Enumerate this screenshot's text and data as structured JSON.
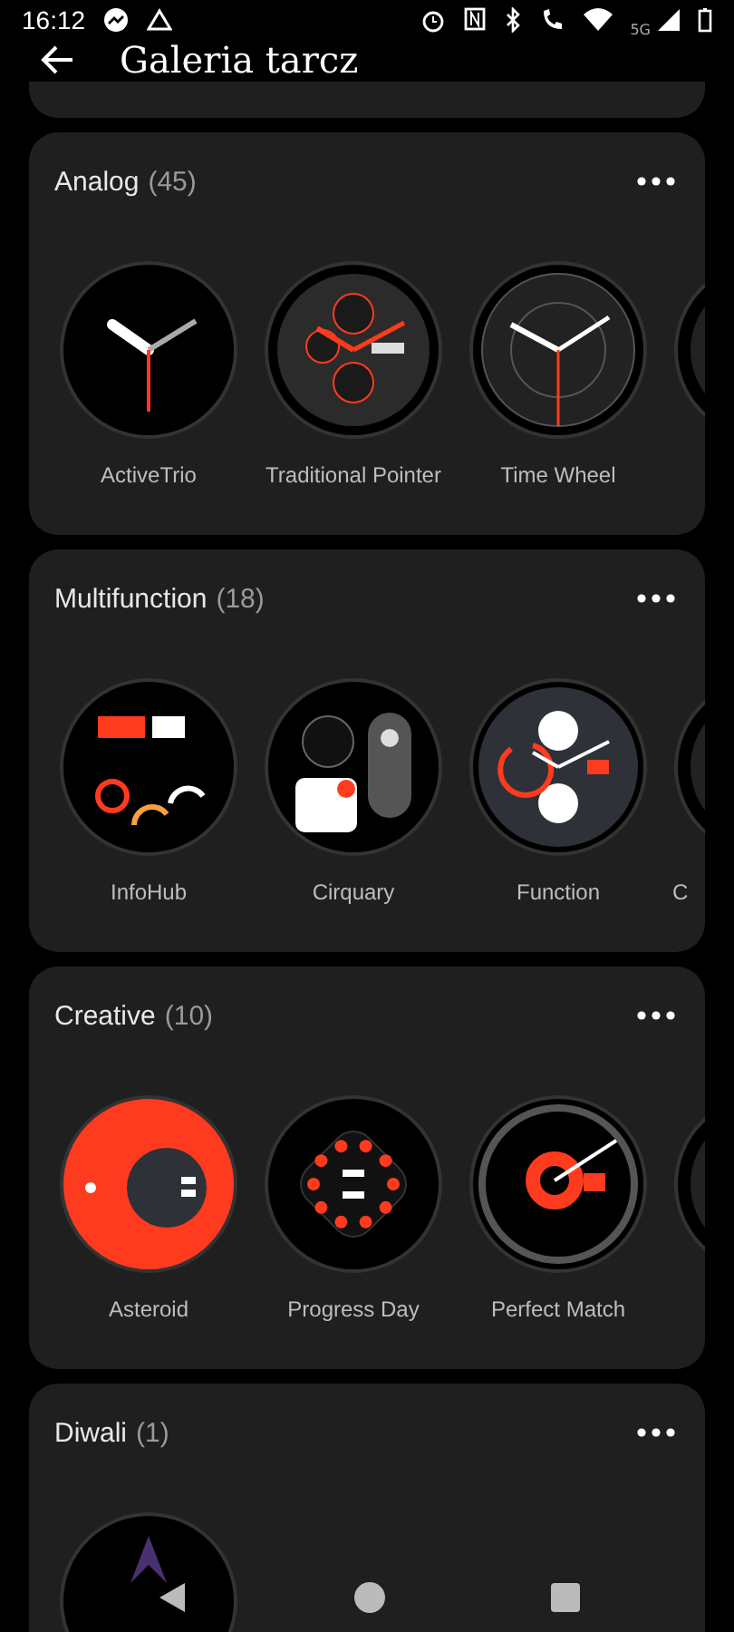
{
  "status_bar": {
    "time": "16:12",
    "network": "5G"
  },
  "header": {
    "title": "Galeria tarcz"
  },
  "categories": [
    {
      "name": "Analog",
      "count": "(45)",
      "faces": [
        {
          "kind": "trio",
          "label": "ActiveTrio"
        },
        {
          "kind": "chrono",
          "label": "Traditional Pointer"
        },
        {
          "kind": "wheel",
          "label": "Time Wheel"
        },
        {
          "kind": "edge"
        }
      ]
    },
    {
      "name": "Multifunction",
      "count": "(18)",
      "faces": [
        {
          "kind": "digital",
          "label": "InfoHub"
        },
        {
          "kind": "widgets",
          "label": "Cirquary"
        },
        {
          "kind": "function",
          "label": "Function"
        },
        {
          "kind": "edge",
          "label": "C"
        }
      ]
    },
    {
      "name": "Creative",
      "count": "(10)",
      "faces": [
        {
          "kind": "ring",
          "label": "Asteroid"
        },
        {
          "kind": "dots",
          "label": "Progress Day"
        },
        {
          "kind": "match",
          "label": "Perfect Match"
        },
        {
          "kind": "edge"
        }
      ]
    },
    {
      "name": "Diwali",
      "count": "(1)",
      "faces": [
        {
          "kind": "festive"
        }
      ]
    }
  ]
}
